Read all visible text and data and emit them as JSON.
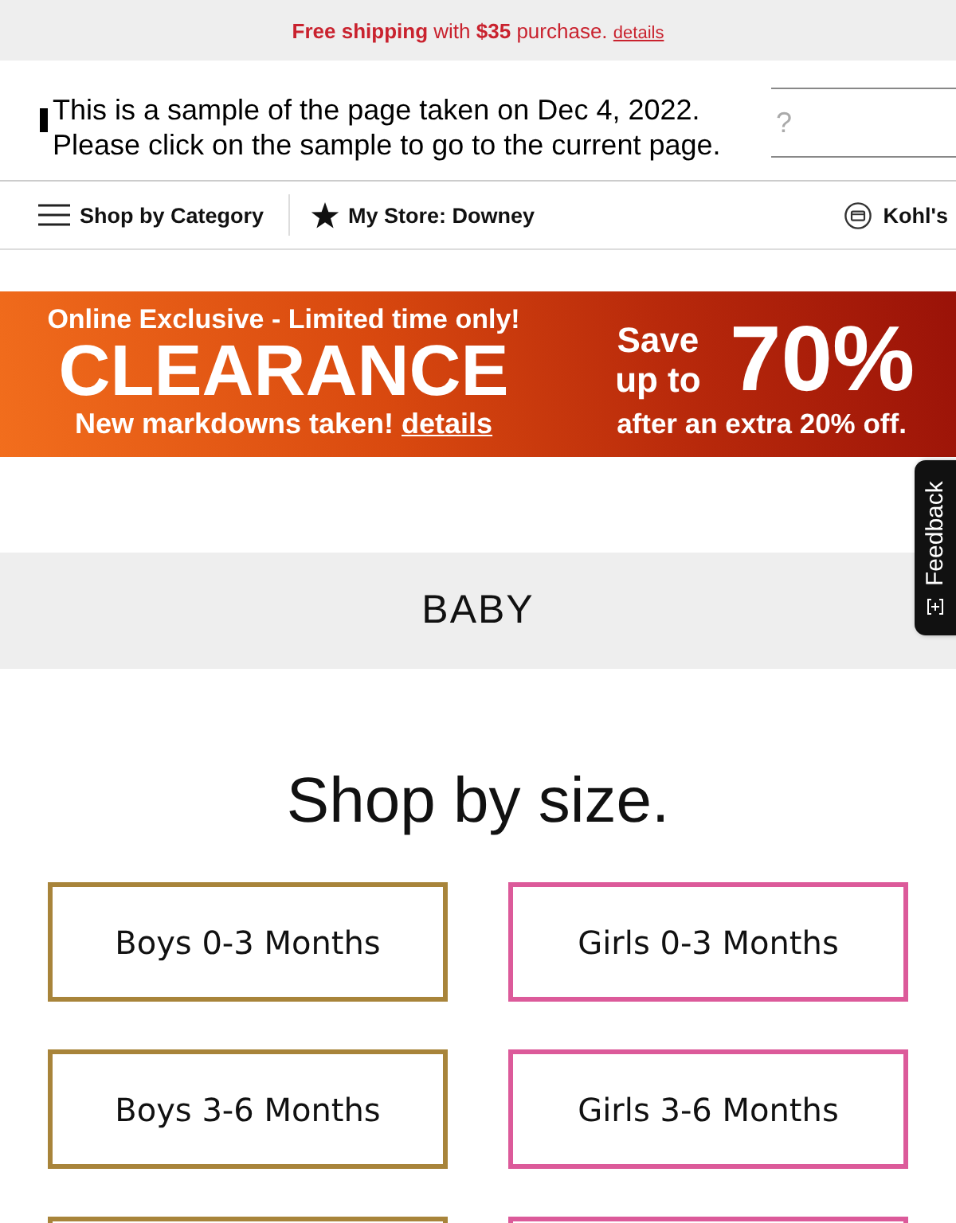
{
  "promo_bar": {
    "text": "**Free shipping** with **$35** purchase.",
    "link": "details"
  },
  "archive_notice": {
    "lines": [
      "This is a sample of the page taken on Dec 4, 2022.",
      "Please click on the sample to go to the current page."
    ]
  },
  "search_field": {
    "placeholder": "?"
  },
  "nav": [
    {
      "kind": "menu",
      "label": "Shop by Category"
    },
    {
      "kind": "store",
      "label": "My Store: Downey"
    },
    {
      "kind": "card",
      "label": "Kohl's"
    }
  ],
  "banner": {
    "headline": "Online Exclusive - Limited time only!",
    "title": "CLEARANCE",
    "subline": "New markdowns taken!",
    "link": "details",
    "save": "Save up to",
    "percent": "70%",
    "note": "after an extra 20% off."
  },
  "feedback_tab": {
    "label": "Feedback"
  },
  "section_title": "BABY",
  "heading": "Shop by size.",
  "size_buttons": [
    {
      "label": "Boys 0-3 Months",
      "color": "#a8843a"
    },
    {
      "label": "Girls 0-3 Months",
      "color": "#dc5a9a"
    },
    {
      "label": "Boys 3-6 Months",
      "color": "#a8843a"
    },
    {
      "label": "Girls 3-6 Months",
      "color": "#dc5a9a"
    },
    {
      "color": "#a8843a"
    },
    {
      "color": "#dc5a9a"
    }
  ]
}
